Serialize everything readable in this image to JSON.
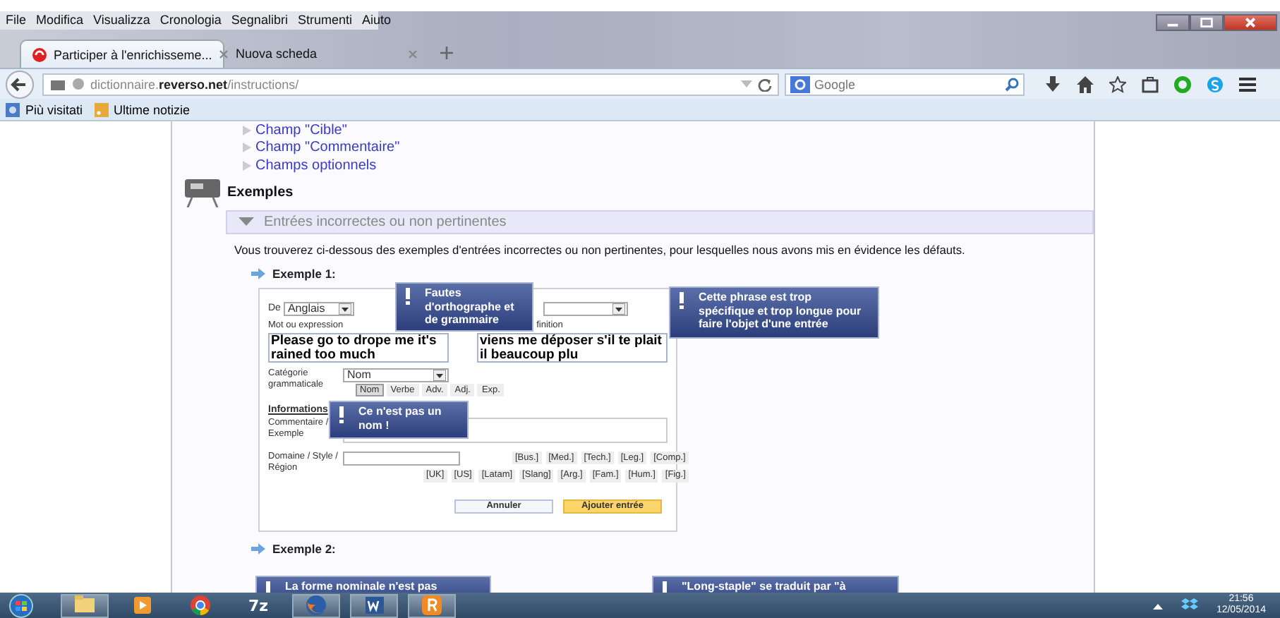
{
  "menu_bar": [
    "File",
    "Modifica",
    "Visualizza",
    "Cronologia",
    "Segnalibri",
    "Strumenti",
    "Aiuto"
  ],
  "tabs": [
    {
      "label": "Participer à l'enrichisseme...",
      "selected": true
    },
    {
      "label": "Nuova scheda",
      "selected": false
    }
  ],
  "address_bar": {
    "url": "dictionnaire.**reverso.net**/instructions/"
  },
  "search": {
    "placeholder": "Google"
  },
  "bookmarks": [
    {
      "label": "Più visitati",
      "kind": "smart"
    },
    {
      "label": "Ultime notizie",
      "kind": "feed"
    }
  ],
  "page": {
    "outline_links": [
      "Champ \"Cible\"",
      "Champ \"Commentaire\"",
      "Champs optionnels"
    ],
    "section_title": "Exemples",
    "subsection": {
      "label": "Entrées incorrectes ou non pertinentes",
      "expanded": true
    },
    "intro": "Vous trouverez ci-dessous des exemples d'entrées incorrectes ou non pertinentes, pour lesquelles nous avons mis en évidence les défauts.",
    "examples": [
      {
        "title": "Exemple 1:",
        "form": {
          "source_label": "De",
          "source_language": "Anglais",
          "term_label": "Mot ou expression",
          "translation_label": "finition",
          "term": "Please go to drope me it's rained too much",
          "translation": "viens me déposer s'il te plait il beaucoup plu",
          "category_label": "Catégorie grammaticale",
          "category": "Nom",
          "pos_buttons": [
            {
              "label": "Nom",
              "selected": true
            },
            {
              "label": "Verbe",
              "selected": false
            },
            {
              "label": "Adv.",
              "selected": false
            },
            {
              "label": "Adj.",
              "selected": false
            },
            {
              "label": "Exp.",
              "selected": false
            }
          ],
          "info_heading": "Informations",
          "comment_label": "Commentaire / Exemple",
          "domain_label": "Domaine / Style / Région",
          "tag_rows": [
            [
              "[Bus.]",
              "[Med.]",
              "[Tech.]",
              "[Leg.]",
              "[Comp.]"
            ],
            [
              "[UK]",
              "[US]",
              "[Latam]",
              "[Slang]",
              "[Arg.]",
              "[Fam.]",
              "[Hum.]",
              "[Fig.]"
            ]
          ],
          "buttons": [
            {
              "label": "Annuler",
              "kind": "secondary"
            },
            {
              "label": "Ajouter entrée",
              "kind": "primary"
            }
          ]
        },
        "callouts": [
          "Fautes d'orthographe et de grammaire",
          "Ce n'est pas un nom !",
          "Cette phrase est trop spécifique et trop longue pour faire l'objet d'une entrée"
        ]
      },
      {
        "title": "Exemple 2:",
        "callouts": [
          "La forme nominale n'est pas",
          "\"Long-staple\" se traduit par \"à"
        ]
      }
    ]
  },
  "taskbar": {
    "apps": [
      {
        "kind": "explorer",
        "running": true
      },
      {
        "kind": "media",
        "running": false
      },
      {
        "kind": "chrome",
        "running": false
      },
      {
        "kind": "sevenzip",
        "label": "7z",
        "running": false
      },
      {
        "kind": "firefox",
        "running": true
      },
      {
        "kind": "word",
        "running": true
      },
      {
        "kind": "reverso",
        "running": true
      }
    ],
    "time": "21:56",
    "date": "12/05/2014"
  }
}
